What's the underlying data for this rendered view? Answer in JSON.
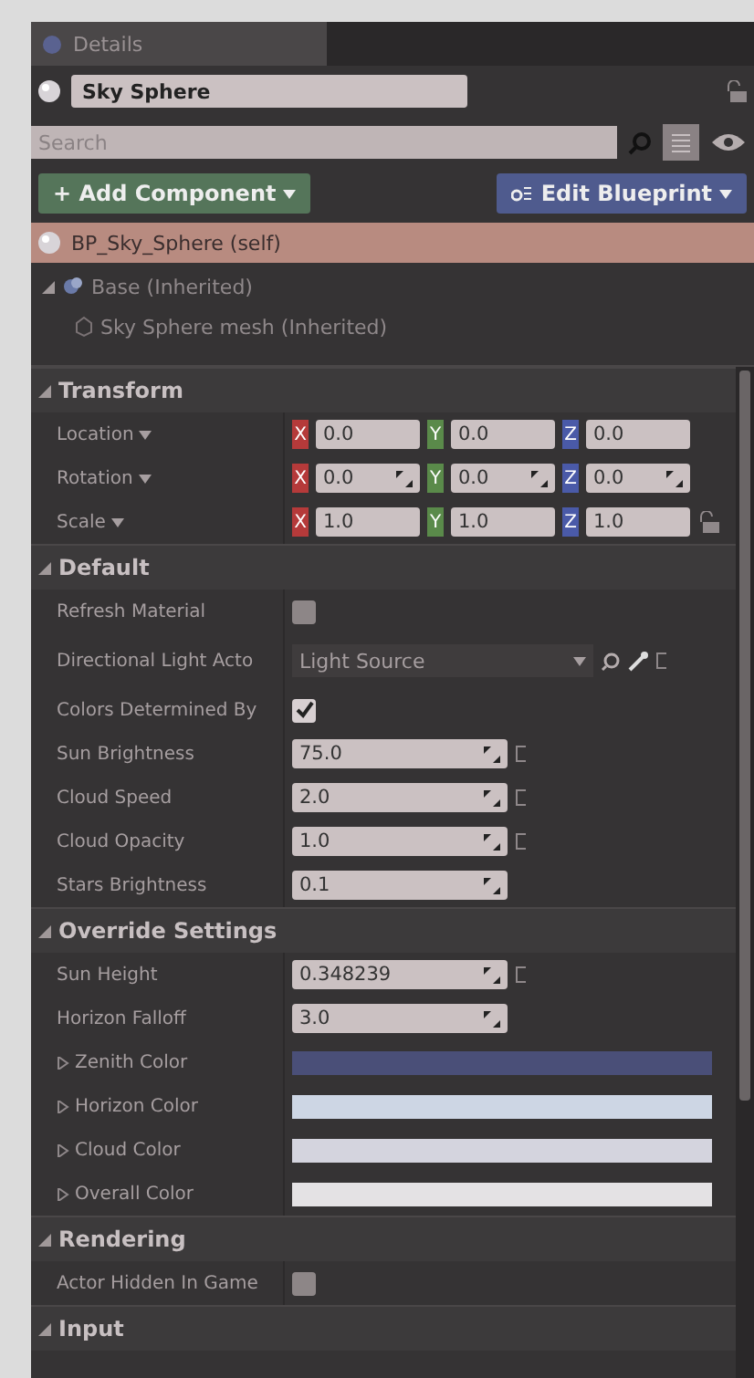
{
  "tab": {
    "label": "Details",
    "selected": true
  },
  "actor_name": {
    "value": "Sky Sphere"
  },
  "search": {
    "placeholder": "Search"
  },
  "buttons": [
    {
      "label": "+ Add Component",
      "kind": "add"
    },
    {
      "label": "Edit Blueprint",
      "kind": "edit"
    }
  ],
  "components": {
    "self": "BP_Sky_Sphere (self)",
    "tree": [
      {
        "label": "Base (Inherited)",
        "expanded": true,
        "children": [
          {
            "label": "Sky Sphere mesh (Inherited)"
          }
        ]
      }
    ]
  },
  "sections": [
    {
      "title": "Transform",
      "expanded": true,
      "rows": [
        {
          "kind": "vector",
          "label": "Location",
          "components": [
            {
              "axis": "X",
              "value": "0.0"
            },
            {
              "axis": "Y",
              "value": "0.0"
            },
            {
              "axis": "Z",
              "value": "0.0"
            }
          ],
          "spinners": false,
          "lock": false
        },
        {
          "kind": "vector",
          "label": "Rotation",
          "components": [
            {
              "axis": "X",
              "value": "0.0"
            },
            {
              "axis": "Y",
              "value": "0.0"
            },
            {
              "axis": "Z",
              "value": "0.0"
            }
          ],
          "spinners": true,
          "lock": false
        },
        {
          "kind": "vector",
          "label": "Scale",
          "components": [
            {
              "axis": "X",
              "value": "1.0"
            },
            {
              "axis": "Y",
              "value": "1.0"
            },
            {
              "axis": "Z",
              "value": "1.0"
            }
          ],
          "spinners": false,
          "lock": true
        }
      ]
    },
    {
      "title": "Default",
      "expanded": true,
      "rows": [
        {
          "kind": "checkbox",
          "label": "Refresh Material",
          "checked": false
        },
        {
          "kind": "object",
          "label": "Directional Light Acto",
          "value": "Light Source",
          "modified": true
        },
        {
          "kind": "checkbox",
          "label": "Colors Determined By",
          "checked": true
        },
        {
          "kind": "number",
          "label": "Sun Brightness",
          "value": "75.0",
          "modified": true
        },
        {
          "kind": "number",
          "label": "Cloud Speed",
          "value": "2.0",
          "modified": true
        },
        {
          "kind": "number",
          "label": "Cloud Opacity",
          "value": "1.0",
          "modified": true
        },
        {
          "kind": "number",
          "label": "Stars Brightness",
          "value": "0.1",
          "modified": false
        }
      ]
    },
    {
      "title": "Override Settings",
      "expanded": true,
      "rows": [
        {
          "kind": "number",
          "label": "Sun Height",
          "value": "0.348239",
          "modified": true
        },
        {
          "kind": "number",
          "label": "Horizon Falloff",
          "value": "3.0",
          "modified": false
        },
        {
          "kind": "color",
          "label": "Zenith Color",
          "color": "#4a4f78",
          "expanded": false
        },
        {
          "kind": "color",
          "label": "Horizon Color",
          "color": "#cdd6e4",
          "expanded": false
        },
        {
          "kind": "color",
          "label": "Cloud Color",
          "color": "#d4d4de",
          "expanded": false
        },
        {
          "kind": "color",
          "label": "Overall Color",
          "color": "#e4e2e4",
          "expanded": false
        }
      ]
    },
    {
      "title": "Rendering",
      "expanded": true,
      "rows": [
        {
          "kind": "checkbox",
          "label": "Actor Hidden In Game",
          "checked": false
        }
      ]
    },
    {
      "title": "Input",
      "expanded": true
    }
  ]
}
